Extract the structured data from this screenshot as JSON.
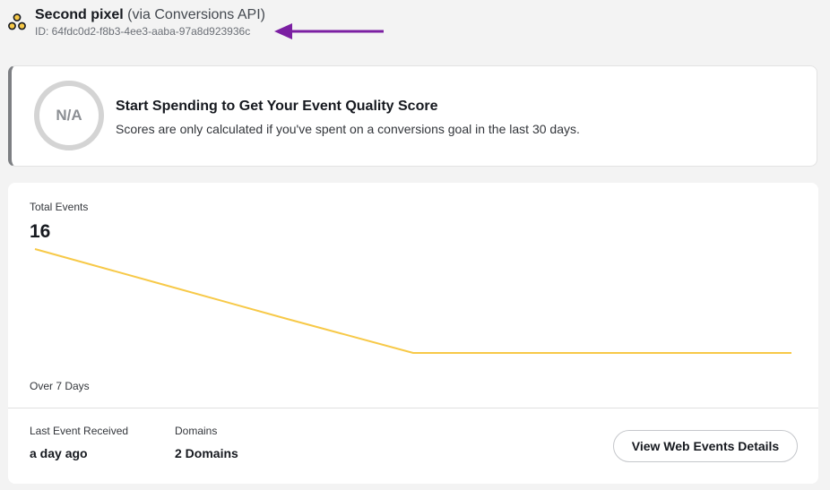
{
  "header": {
    "pixel_name": "Second pixel",
    "pixel_source": " (via Conversions API)",
    "pixel_id": "ID: 64fdc0d2-f8b3-4ee3-aaba-97a8d923936c",
    "icon": "pixel-icon",
    "annotation_arrow_color": "#7b1fa2"
  },
  "score_card": {
    "score": "N/A",
    "title": "Start Spending to Get Your Event Quality Score",
    "description": "Scores are only calculated if you've spent on a conversions goal in the last 30 days."
  },
  "events": {
    "total_label": "Total Events",
    "total_value": "16",
    "period_label": "Over 7 Days",
    "line_color": "#f7c948",
    "chart_data": {
      "type": "line",
      "x": [
        1,
        2,
        3,
        4,
        5,
        6,
        7
      ],
      "values": [
        16,
        12.3,
        8.6,
        5,
        5,
        5,
        5
      ]
    },
    "last_event_label": "Last Event Received",
    "last_event_value": "a day ago",
    "domains_label": "Domains",
    "domains_value": "2 Domains",
    "details_button": "View Web Events Details"
  }
}
